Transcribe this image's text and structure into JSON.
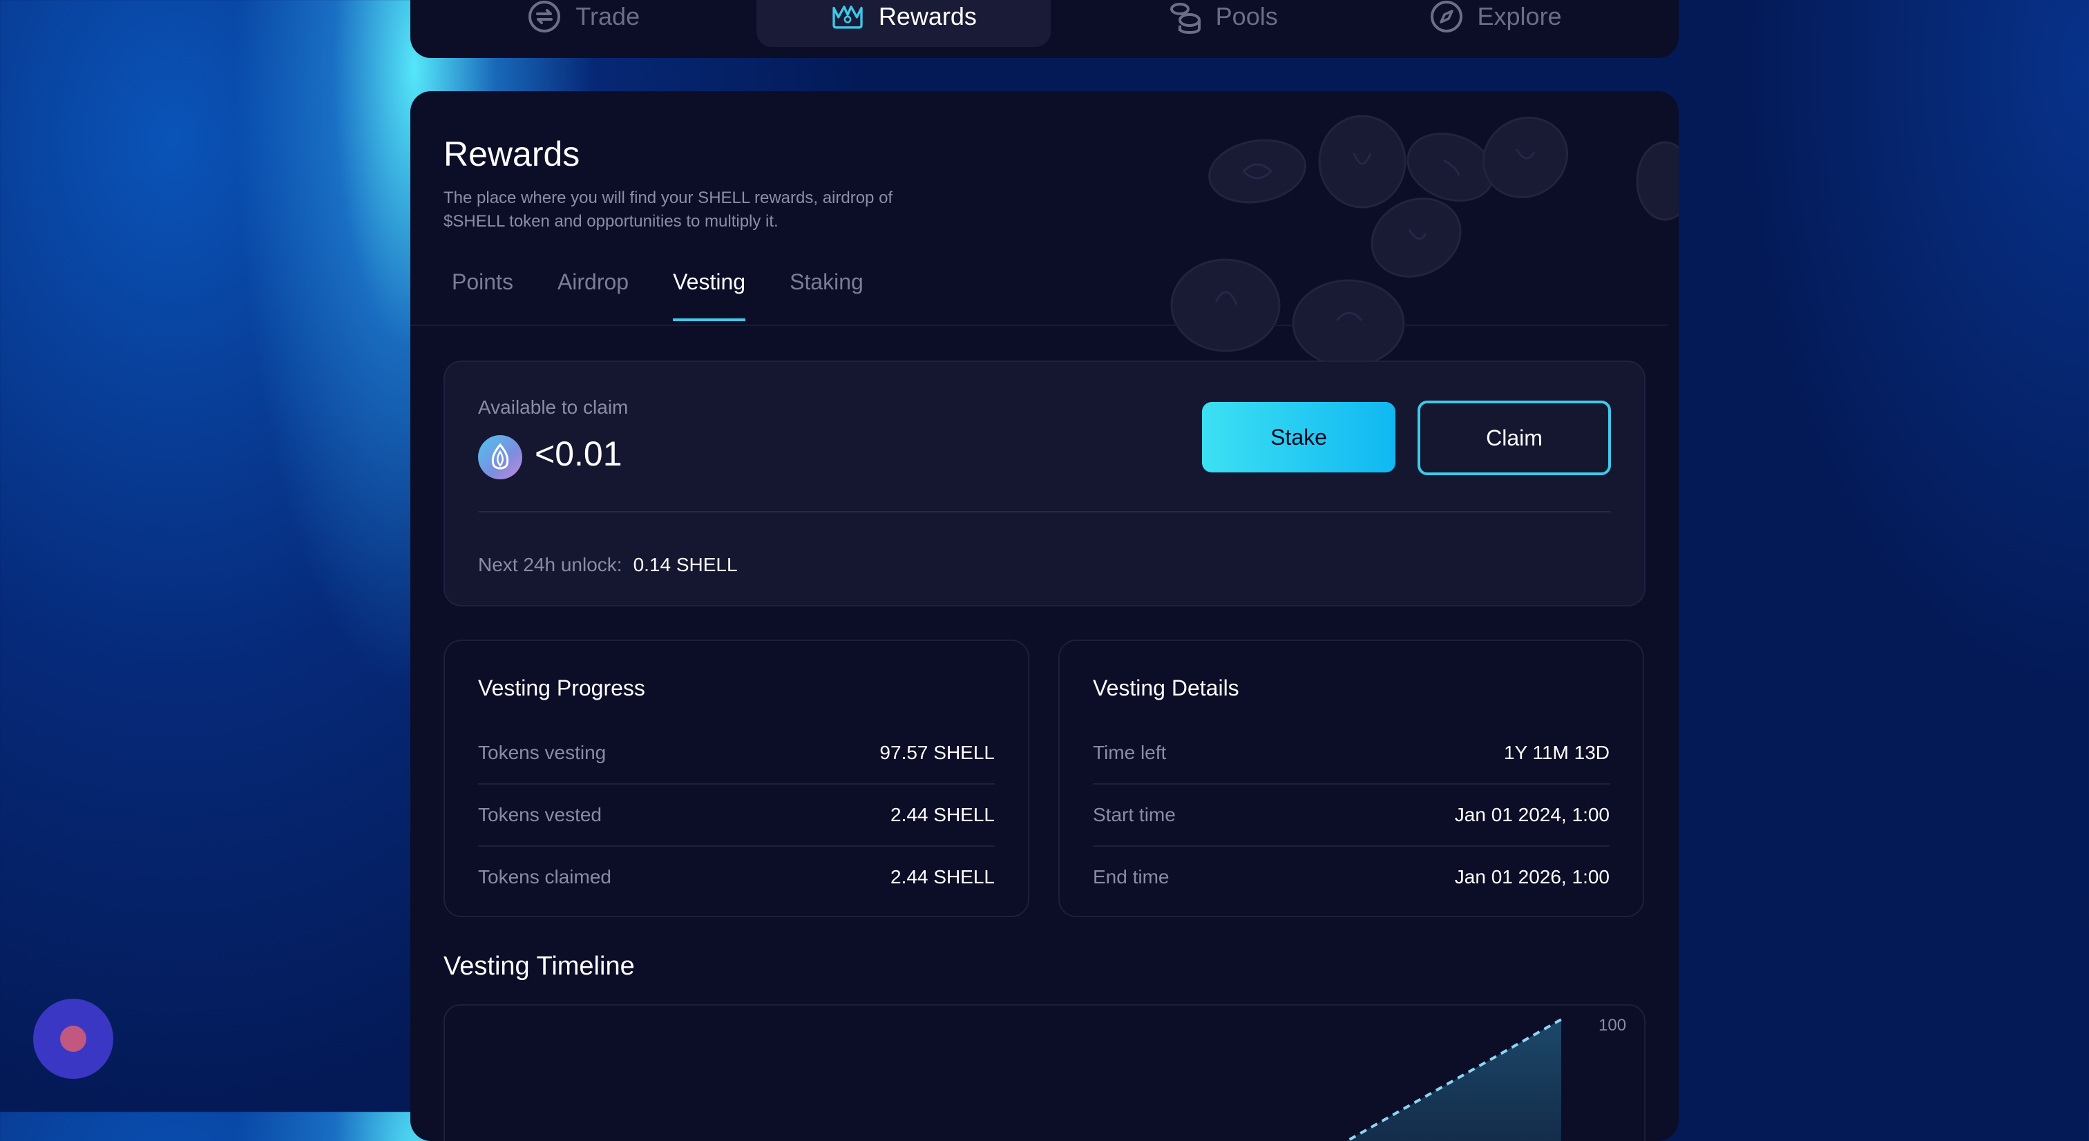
{
  "nav": {
    "tabs": [
      {
        "label": "Trade",
        "icon": "swap-icon"
      },
      {
        "label": "Rewards",
        "icon": "crown-icon",
        "active": true
      },
      {
        "label": "Pools",
        "icon": "coins-stack-icon"
      },
      {
        "label": "Explore",
        "icon": "compass-icon"
      }
    ]
  },
  "header": {
    "title": "Rewards",
    "description": "The place where you will find your SHELL rewards, airdrop of $SHELL token and opportunities to multiply it."
  },
  "sub_tabs": [
    {
      "label": "Points"
    },
    {
      "label": "Airdrop"
    },
    {
      "label": "Vesting",
      "active": true
    },
    {
      "label": "Staking"
    }
  ],
  "claim": {
    "available_label": "Available to claim",
    "amount": "<0.01",
    "token_icon": "shell-token-icon",
    "stake_label": "Stake",
    "claim_label": "Claim",
    "unlock_label": "Next 24h unlock:",
    "unlock_value": "0.14 SHELL"
  },
  "vesting_progress": {
    "title": "Vesting Progress",
    "rows": [
      {
        "label": "Tokens vesting",
        "value": "97.57 SHELL"
      },
      {
        "label": "Tokens vested",
        "value": "2.44 SHELL"
      },
      {
        "label": "Tokens claimed",
        "value": "2.44 SHELL"
      }
    ]
  },
  "vesting_details": {
    "title": "Vesting Details",
    "rows": [
      {
        "label": "Time left",
        "value": "1Y 11M 13D"
      },
      {
        "label": "Start time",
        "value": "Jan 01 2024, 1:00"
      },
      {
        "label": "End time",
        "value": "Jan 01 2026, 1:00"
      }
    ]
  },
  "timeline": {
    "title": "Vesting Timeline",
    "y_tick_top": "100"
  },
  "colors": {
    "accent": "#3ec9ea",
    "card_bg": "#0c0d26",
    "panel_bg": "#15162f",
    "chat_bubble": "#3b37c5"
  }
}
